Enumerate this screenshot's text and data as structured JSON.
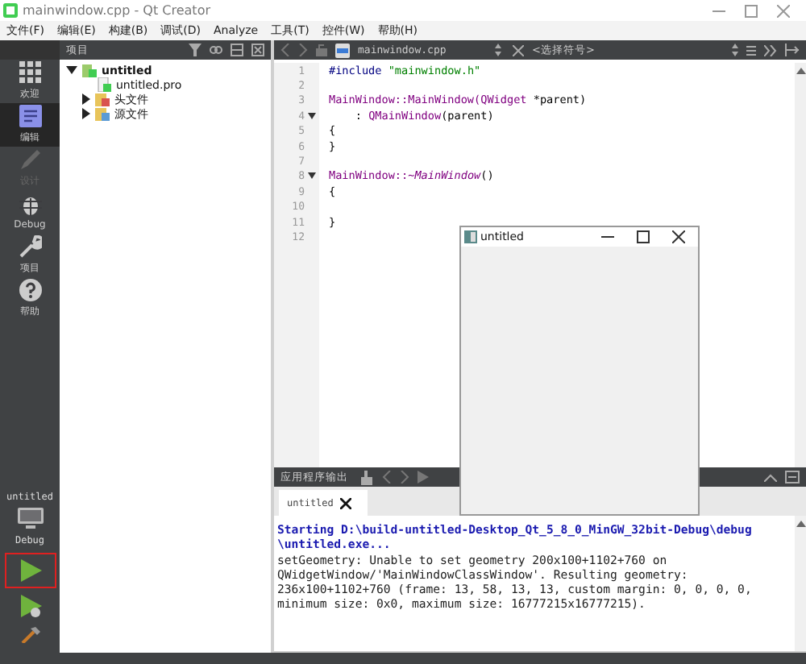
{
  "window": {
    "title": "mainwindow.cpp - Qt Creator"
  },
  "menu": [
    "文件(F)",
    "编辑(E)",
    "构建(B)",
    "调试(D)",
    "Analyze",
    "工具(T)",
    "控件(W)",
    "帮助(H)"
  ],
  "modes": [
    {
      "label": "欢迎",
      "kind": "grid",
      "selected": false,
      "disabled": false
    },
    {
      "label": "编辑",
      "kind": "edit",
      "selected": true,
      "disabled": false
    },
    {
      "label": "设计",
      "kind": "pen",
      "selected": false,
      "disabled": true
    },
    {
      "label": "Debug",
      "kind": "bug",
      "selected": false,
      "disabled": false
    },
    {
      "label": "项目",
      "kind": "wrench",
      "selected": false,
      "disabled": false
    },
    {
      "label": "帮助",
      "kind": "help",
      "selected": false,
      "disabled": false
    }
  ],
  "kit": {
    "project": "untitled",
    "config": "Debug"
  },
  "project_panel": {
    "header": "项目",
    "tree": [
      {
        "label": "untitled",
        "kind": "project",
        "expanded": true,
        "children": [
          {
            "label": "untitled.pro",
            "kind": "pro"
          },
          {
            "label": "头文件",
            "kind": "headers",
            "expanded": false
          },
          {
            "label": "源文件",
            "kind": "sources",
            "expanded": false
          }
        ]
      }
    ]
  },
  "editor": {
    "file": "mainwindow.cpp",
    "symbol": "<选择符号>",
    "lines": [
      {
        "number": "1",
        "fold": false,
        "code": [
          {
            "text": "#include ",
            "kind": "directive"
          },
          {
            "text": "\"mainwindow.h\"",
            "kind": "string"
          }
        ]
      },
      {
        "number": "2",
        "fold": false
      },
      {
        "number": "3",
        "fold": false,
        "code": [
          {
            "text": "MainWindow::MainWindow(",
            "kind": "type"
          },
          {
            "text": "QWidget",
            "kind": "type"
          },
          {
            "text": " *parent)",
            "kind": "plain"
          }
        ]
      },
      {
        "number": "4",
        "fold": true,
        "code": [
          {
            "text": "    : ",
            "kind": "plain"
          },
          {
            "text": "QMainWindow",
            "kind": "type"
          },
          {
            "text": "(parent)",
            "kind": "plain"
          }
        ]
      },
      {
        "number": "5",
        "fold": false,
        "code": [
          {
            "text": "{",
            "kind": "plain"
          }
        ]
      },
      {
        "number": "6",
        "fold": false,
        "code": [
          {
            "text": "}",
            "kind": "plain"
          }
        ]
      },
      {
        "number": "7",
        "fold": false
      },
      {
        "number": "8",
        "fold": true,
        "code": [
          {
            "text": "MainWindow::",
            "kind": "type"
          },
          {
            "text": "~MainWindow",
            "kind": "italic"
          },
          {
            "text": "()",
            "kind": "plain"
          }
        ]
      },
      {
        "number": "9",
        "fold": false,
        "code": [
          {
            "text": "{",
            "kind": "plain"
          }
        ]
      },
      {
        "number": "10",
        "fold": false
      },
      {
        "number": "11",
        "fold": false,
        "code": [
          {
            "text": "}",
            "kind": "plain"
          }
        ]
      },
      {
        "number": "12",
        "fold": false
      }
    ]
  },
  "app_window": {
    "title": "untitled"
  },
  "output": {
    "header": "应用程序输出",
    "tab": "untitled",
    "lines": [
      {
        "text": "Starting D:\\build-untitled-Desktop_Qt_5_8_0_MinGW_32bit-Debug\\debug",
        "kind": "info"
      },
      {
        "text": "\\untitled.exe...",
        "kind": "info"
      },
      {
        "text": "setGeometry: Unable to set geometry 200x100+1102+760 on",
        "kind": "plain"
      },
      {
        "text": "QWidgetWindow/'MainWindowClassWindow'. Resulting geometry:",
        "kind": "plain"
      },
      {
        "text": "236x100+1102+760 (frame: 13, 58, 13, 13, custom margin: 0, 0, 0, 0,",
        "kind": "plain"
      },
      {
        "text": "minimum size: 0x0, maximum size: 16777215x16777215).",
        "kind": "plain"
      }
    ]
  }
}
